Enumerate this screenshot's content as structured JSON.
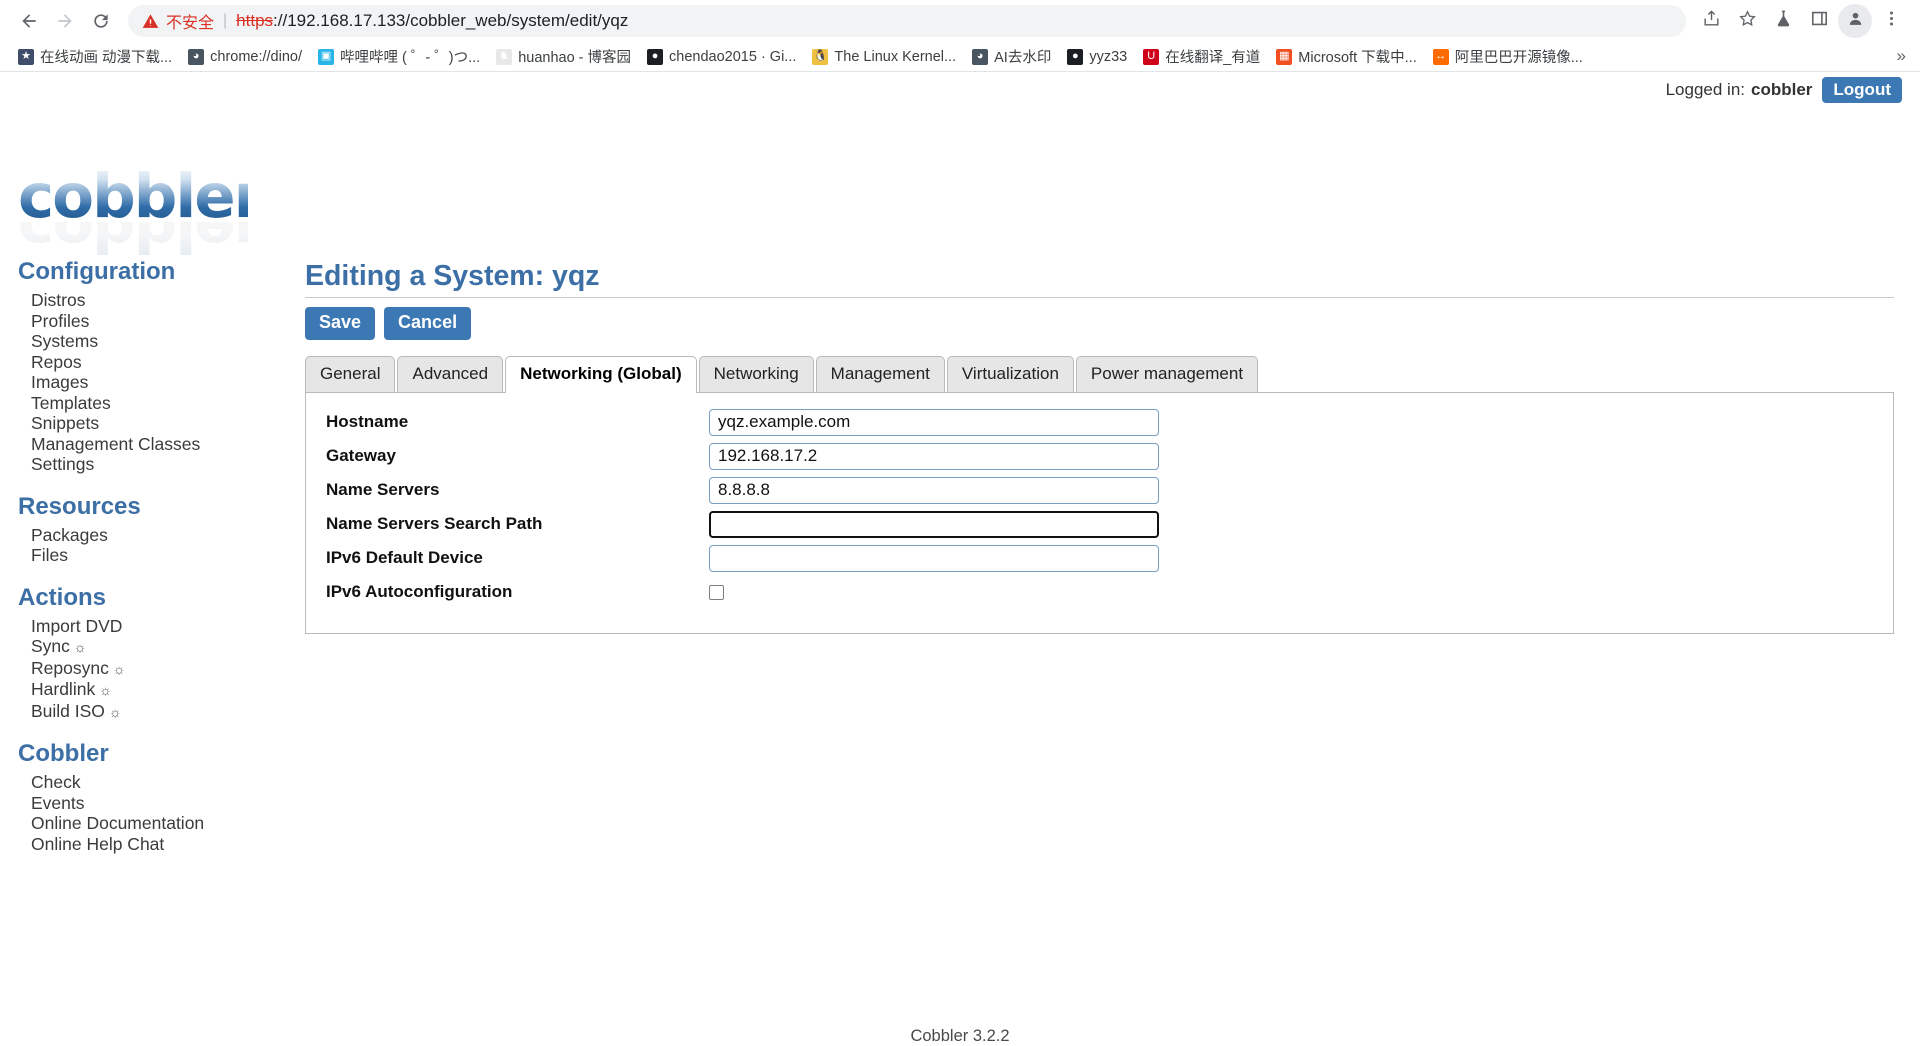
{
  "browser": {
    "back_icon": "back-arrow-icon",
    "forward_icon": "forward-arrow-icon",
    "reload_icon": "reload-icon",
    "security_warning_icon": "warning-triangle-icon",
    "security_text": "不安全",
    "url_scheme": "https",
    "url_rest": "://192.168.17.133/cobbler_web/system/edit/yqz",
    "share_icon": "share-icon",
    "bookmark_icon": "star-icon",
    "experiments_icon": "flask-icon",
    "sidepanel_icon": "side-panel-icon",
    "profile_icon": "avatar-icon",
    "menu_icon": "three-dot-menu-icon",
    "bookmarks_overflow": "»",
    "bookmarks": [
      {
        "label": "在线动画 动漫下载...",
        "favicon_color": "#3f4d6b",
        "favicon_char": "★"
      },
      {
        "label": "chrome://dino/",
        "favicon_color": "#4a5562",
        "favicon_char": "◕"
      },
      {
        "label": "哔哩哔哩 ( ゜- ゜)つ...",
        "favicon_color": "#29b5e8",
        "favicon_char": "▣"
      },
      {
        "label": "huanhao - 博客园",
        "favicon_color": "#e8e8e8",
        "favicon_char": "♞"
      },
      {
        "label": "chendao2015 · Gi...",
        "favicon_color": "#1b1f23",
        "favicon_char": "●"
      },
      {
        "label": "The Linux Kernel...",
        "favicon_color": "#f0c040",
        "favicon_char": "🐧"
      },
      {
        "label": "AI去水印",
        "favicon_color": "#4a5562",
        "favicon_char": "◕"
      },
      {
        "label": "yyz33",
        "favicon_color": "#1b1f23",
        "favicon_char": "●"
      },
      {
        "label": "在线翻译_有道",
        "favicon_color": "#d0021b",
        "favicon_char": "U"
      },
      {
        "label": "Microsoft 下载中...",
        "favicon_color": "#f25022",
        "favicon_char": "▦"
      },
      {
        "label": "阿里巴巴开源镜像...",
        "favicon_color": "#ff6a00",
        "favicon_char": "↔"
      }
    ]
  },
  "header": {
    "logged_in_prefix": "Logged in:",
    "username": "cobbler",
    "logout_label": "Logout",
    "logo_text": "cobbler"
  },
  "sidebar": {
    "sections": [
      {
        "title": "Configuration",
        "items": [
          {
            "label": "Distros",
            "gear": false
          },
          {
            "label": "Profiles",
            "gear": false
          },
          {
            "label": "Systems",
            "gear": false
          },
          {
            "label": "Repos",
            "gear": false
          },
          {
            "label": "Images",
            "gear": false
          },
          {
            "label": "Templates",
            "gear": false
          },
          {
            "label": "Snippets",
            "gear": false
          },
          {
            "label": "Management Classes",
            "gear": false
          },
          {
            "label": "Settings",
            "gear": false
          }
        ]
      },
      {
        "title": "Resources",
        "items": [
          {
            "label": "Packages",
            "gear": false
          },
          {
            "label": "Files",
            "gear": false
          }
        ]
      },
      {
        "title": "Actions",
        "items": [
          {
            "label": "Import DVD",
            "gear": false
          },
          {
            "label": "Sync",
            "gear": true
          },
          {
            "label": "Reposync",
            "gear": true
          },
          {
            "label": "Hardlink",
            "gear": true
          },
          {
            "label": "Build ISO",
            "gear": true
          }
        ]
      },
      {
        "title": "Cobbler",
        "items": [
          {
            "label": "Check",
            "gear": false
          },
          {
            "label": "Events",
            "gear": false
          },
          {
            "label": "Online Documentation",
            "gear": false
          },
          {
            "label": "Online Help Chat",
            "gear": false
          }
        ]
      }
    ],
    "gear_glyph": "☼"
  },
  "main": {
    "page_title": "Editing a System: yqz",
    "save_label": "Save",
    "cancel_label": "Cancel",
    "tabs": [
      {
        "label": "General",
        "active": false
      },
      {
        "label": "Advanced",
        "active": false
      },
      {
        "label": "Networking (Global)",
        "active": true
      },
      {
        "label": "Networking",
        "active": false
      },
      {
        "label": "Management",
        "active": false
      },
      {
        "label": "Virtualization",
        "active": false
      },
      {
        "label": "Power management",
        "active": false
      }
    ],
    "fields": [
      {
        "label": "Hostname",
        "type": "text",
        "value": "yqz.example.com",
        "focused": false
      },
      {
        "label": "Gateway",
        "type": "text",
        "value": "192.168.17.2",
        "focused": false
      },
      {
        "label": "Name Servers",
        "type": "text",
        "value": "8.8.8.8",
        "focused": false
      },
      {
        "label": "Name Servers Search Path",
        "type": "text",
        "value": "",
        "focused": true
      },
      {
        "label": "IPv6 Default Device",
        "type": "text",
        "value": "",
        "focused": false
      },
      {
        "label": "IPv6 Autoconfiguration",
        "type": "checkbox",
        "checked": false,
        "focused": false
      }
    ]
  },
  "footer": {
    "text": "Cobbler 3.2.2"
  },
  "colors": {
    "accent": "#3c78b4",
    "heading": "#3c6fa5",
    "danger": "#d93025",
    "chrome_bg": "#ffffff"
  }
}
